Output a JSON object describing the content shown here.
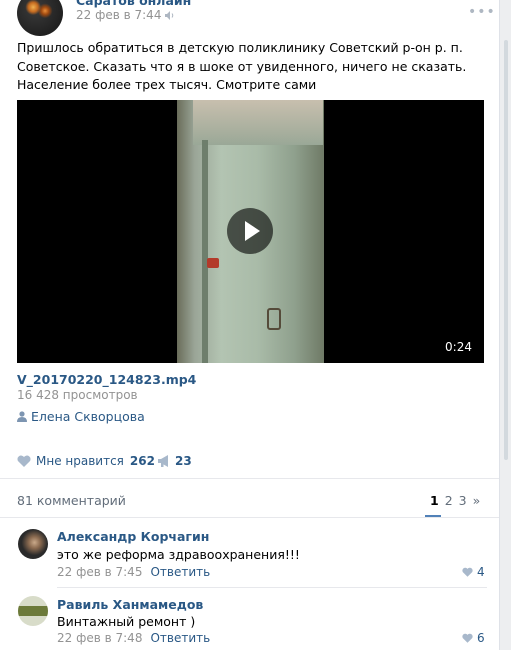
{
  "post": {
    "group_name": "Саратов онлайн",
    "date": "22 фев в 7:44",
    "text": "Пришлось обратиться в детскую поликлинику Советский р-он р. п. Советское. Сказать что я в шоке от увиденного, ничего не сказать. Население более трех тысяч. Смотрите сами"
  },
  "video": {
    "duration": "0:24",
    "title": "V_20170220_124823.mp4",
    "views": "16 428 просмотров",
    "author": "Елена Скворцова"
  },
  "actions": {
    "like_label": "Мне нравится",
    "like_count": "262",
    "share_count": "23"
  },
  "comments_header": {
    "count_label": "81 комментарий",
    "pages": [
      "1",
      "2",
      "3",
      "»"
    ]
  },
  "comments": [
    {
      "name": "Александр Корчагин",
      "text": "это же реформа здравоохранения!!!",
      "date": "22 фев в 7:45",
      "reply_label": "Ответить",
      "likes": "4"
    },
    {
      "name": "Равиль Ханмамедов",
      "text": "Винтажный ремонт )",
      "date": "22 фев в 7:48",
      "reply_label": "Ответить",
      "likes": "6"
    }
  ],
  "colors": {
    "link": "#2a5885",
    "muted": "#939393",
    "accent": "#5181b8"
  }
}
